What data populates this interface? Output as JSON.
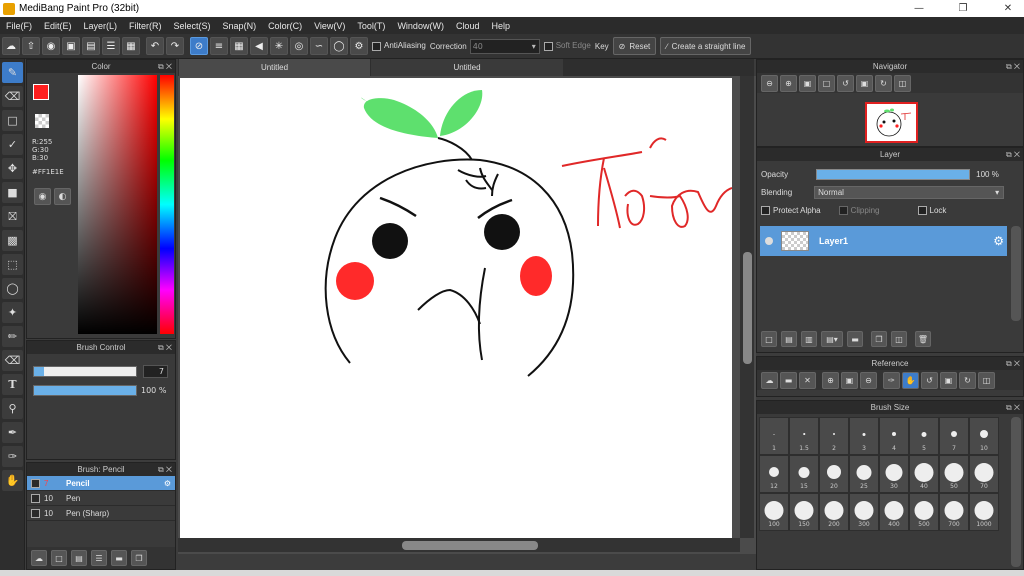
{
  "window": {
    "title": "MediBang Paint Pro (32bit)"
  },
  "menu": [
    "File(F)",
    "Edit(E)",
    "Layer(L)",
    "Filter(R)",
    "Select(S)",
    "Snap(N)",
    "Color(C)",
    "View(V)",
    "Tool(T)",
    "Window(W)",
    "Cloud",
    "Help"
  ],
  "toolbar": {
    "antialiasing": "AntiAliasing",
    "correction_label": "Correction",
    "correction_value": "40",
    "soft_edge": "Soft Edge",
    "key": "Key",
    "reset": "Reset",
    "straight_line": "Create a straight line"
  },
  "color_panel": {
    "title": "Color",
    "fg_color": "#FF1E1E",
    "bg_color": "#31E040",
    "r": "R:255",
    "g": "G:30",
    "b": "B:30",
    "hex": "#FF1E1E"
  },
  "brush_control": {
    "title": "Brush Control",
    "size": "7",
    "size_fraction": 0.1,
    "opacity": "100 %",
    "opacity_fraction": 1.0
  },
  "brush_panel": {
    "title": "Brush: Pencil",
    "items": [
      {
        "size": "7",
        "name": "Pencil",
        "selected": true
      },
      {
        "size": "10",
        "name": "Pen",
        "selected": false
      },
      {
        "size": "10",
        "name": "Pen (Sharp)",
        "selected": false
      }
    ]
  },
  "tabs": [
    {
      "label": "Untitled"
    },
    {
      "label": "Untitled"
    }
  ],
  "canvas": {
    "handwriting": "Thảo"
  },
  "navigator": {
    "title": "Navigator"
  },
  "layer_panel": {
    "title": "Layer",
    "opacity_label": "Opacity",
    "opacity_value": "100 %",
    "blending_label": "Blending",
    "blending_value": "Normal",
    "protect_alpha": "Protect Alpha",
    "clipping": "Clipping",
    "lock": "Lock",
    "layer_name": "Layer1"
  },
  "reference": {
    "title": "Reference"
  },
  "brush_size": {
    "title": "Brush Size",
    "sizes": [
      "1",
      "1.5",
      "2",
      "3",
      "4",
      "5",
      "7",
      "10",
      "12",
      "15",
      "20",
      "25",
      "30",
      "40",
      "50",
      "70",
      "100",
      "150",
      "200",
      "300",
      "400",
      "500",
      "700",
      "1000"
    ]
  }
}
